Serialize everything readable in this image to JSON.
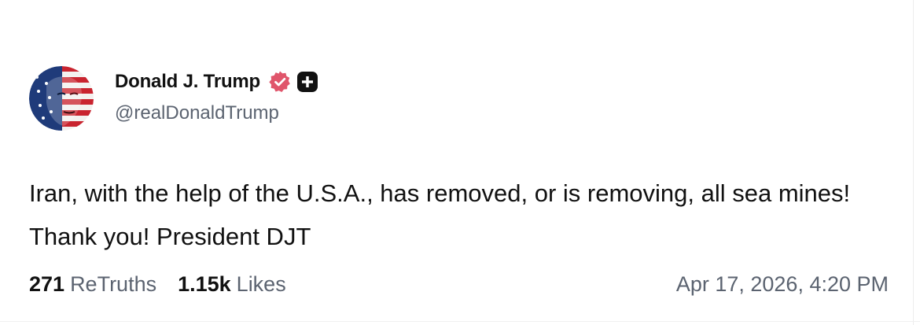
{
  "author": {
    "display_name": "Donald J. Trump",
    "handle": "@realDonaldTrump",
    "avatar_icon": "flag-face-avatar",
    "verified_icon": "verified-badge-icon",
    "verified_color": "#e0556b",
    "plus_icon": "plus-badge-icon"
  },
  "post": {
    "text": "Iran, with the help of the U.S.A., has removed, or is removing, all sea mines! Thank you! President DJT"
  },
  "stats": {
    "retruths_count": "271",
    "retruths_label": "ReTruths",
    "likes_count": "1.15k",
    "likes_label": "Likes"
  },
  "timestamp": "Apr 17, 2026, 4:20 PM"
}
